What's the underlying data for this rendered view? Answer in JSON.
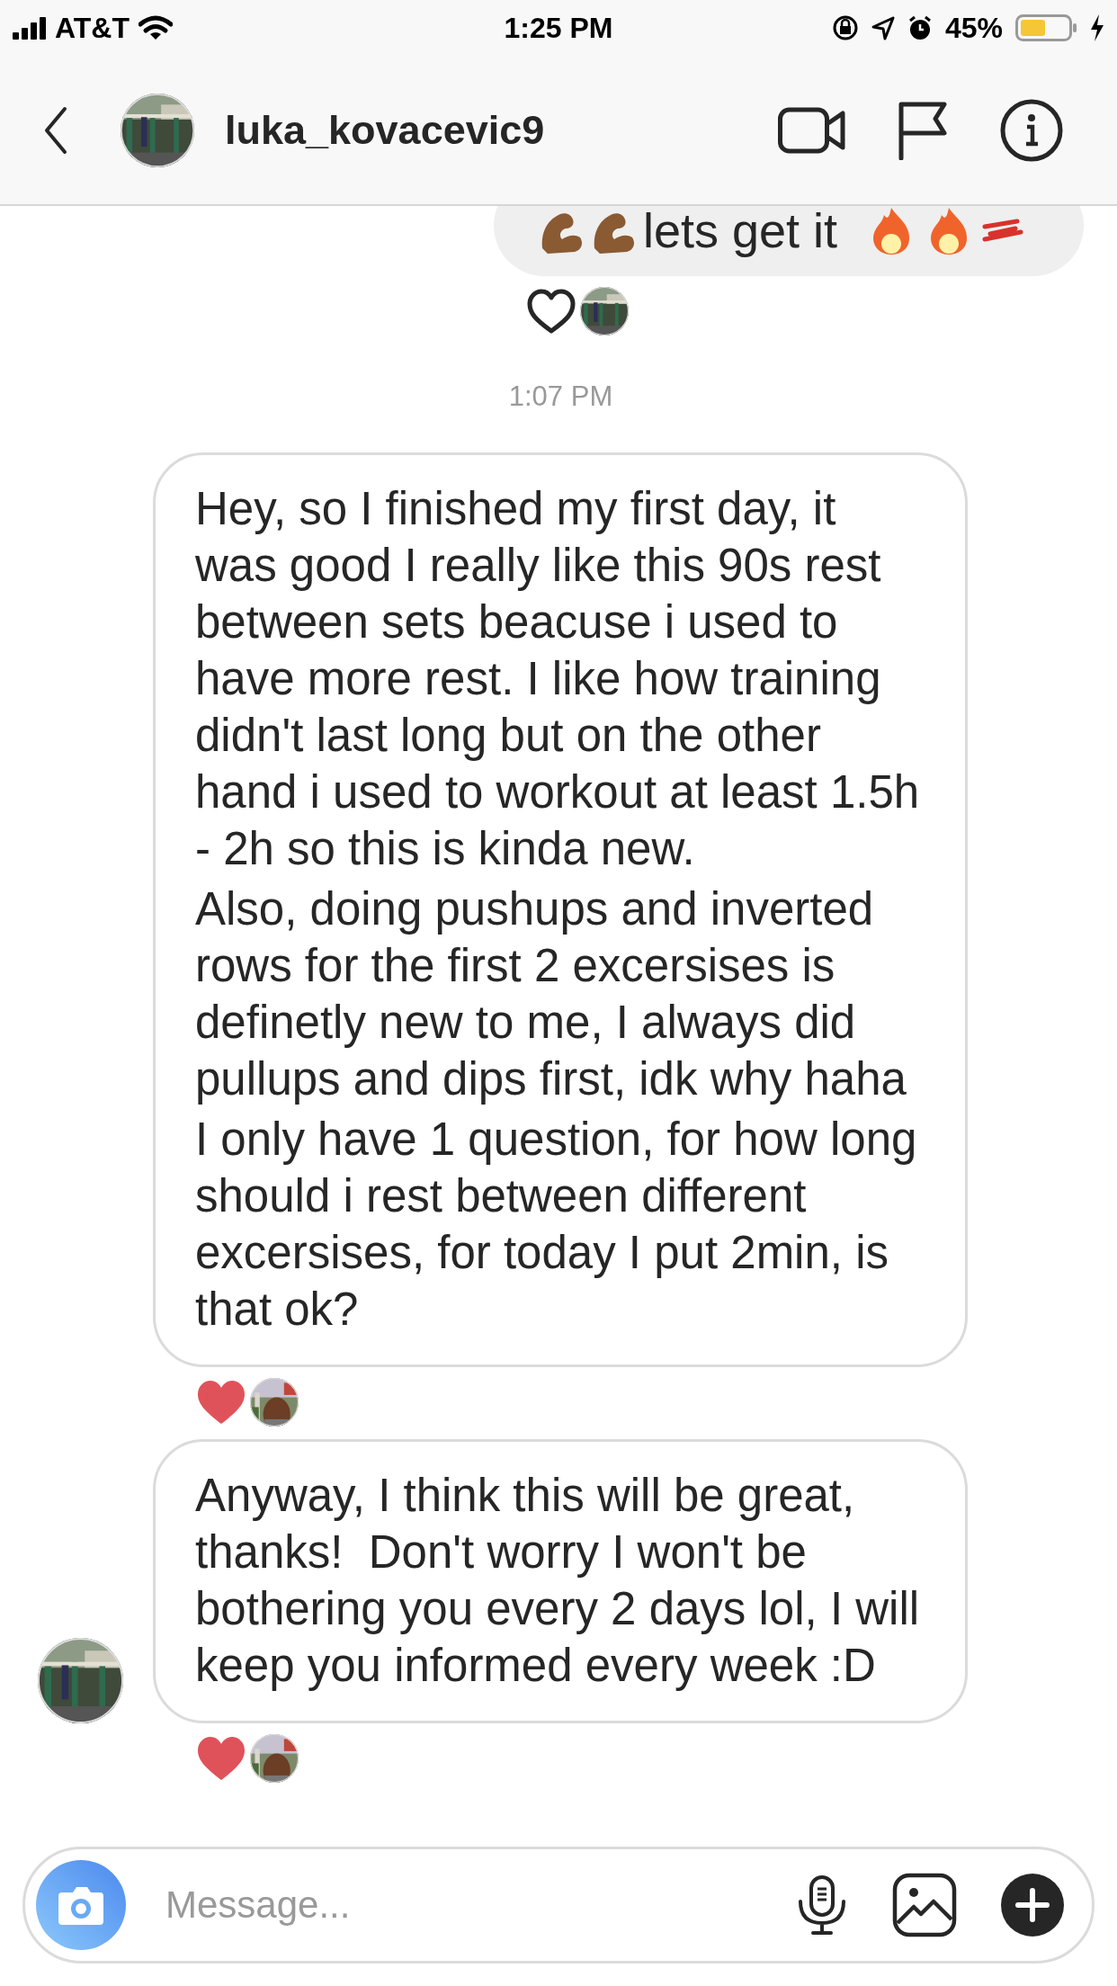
{
  "status_bar": {
    "carrier": "AT&T",
    "time": "1:25 PM",
    "battery": "45%"
  },
  "header": {
    "username": "luka_kovacevic9"
  },
  "thread": [
    {
      "kind": "outgoing",
      "text": "lets get it",
      "reaction": {
        "liked": false
      }
    },
    {
      "kind": "timestamp",
      "text": "1:07 PM"
    },
    {
      "kind": "incoming",
      "show_avatar": false,
      "paragraphs": [
        "Hey, so I finished my first day, it was good I really like this 90s rest between sets beacuse i used to have more rest. I like how training didn't last long but on the other hand i used to workout at least 1.5h - 2h so this is kinda new.",
        "Also, doing pushups and inverted rows for the first 2 excersises is definetly new to me, I always did pullups and dips first, idk why haha",
        "I only have 1 question, for how long should i rest between different excersises, for today I put 2min, is that ok?"
      ],
      "reaction": {
        "liked": true
      }
    },
    {
      "kind": "incoming",
      "show_avatar": true,
      "paragraphs": [
        "Anyway, I think this will be great, thanks!  Don't worry I won't be bothering you every 2 days lol, I will keep you informed every week :D"
      ],
      "reaction": {
        "liked": true
      }
    }
  ],
  "composer": {
    "placeholder": "Message..."
  }
}
